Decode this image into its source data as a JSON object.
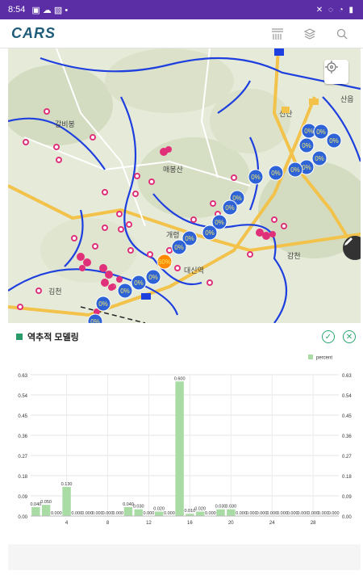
{
  "status_bar": {
    "time": "8:54",
    "icons": [
      "image-icon",
      "cloud-icon",
      "gallery-icon",
      "dot-icon",
      "bluetooth-off-icon",
      "mute-icon",
      "wifi-icon",
      "alarm-icon",
      "battery-icon"
    ]
  },
  "app": {
    "logo": "CARS"
  },
  "toolbar": {
    "icons": [
      "layers-list-icon",
      "layers-icon",
      "search-icon"
    ]
  },
  "map": {
    "labels": [
      "갈비봉",
      "매봉산",
      "개령",
      "대신역",
      "김천",
      "선산",
      "산읍",
      "감천"
    ],
    "bubble_labels": [
      "0%",
      "0%",
      "0%",
      "0%",
      "0%",
      "0%",
      "0%",
      "0%",
      "0%",
      "0%",
      "0%",
      "0%",
      "0%",
      "0%",
      "0%",
      "0%",
      "0%",
      "0%",
      "0%",
      "60%",
      "0%",
      "0%",
      "0%"
    ]
  },
  "panel": {
    "title": "역추적 모델링",
    "confirm_icon": "check-circle-icon",
    "close_icon": "close-circle-icon"
  },
  "chart_data": {
    "type": "bar",
    "legend": "percent",
    "color": "#a9dba5",
    "ylim": [
      0,
      0.63
    ],
    "yticks": [
      "0.00",
      "0.09",
      "0.18",
      "0.27",
      "0.36",
      "0.45",
      "0.54",
      "0.63"
    ],
    "xticks": [
      4,
      8,
      12,
      16,
      20,
      24,
      28
    ],
    "x": [
      1,
      2,
      3,
      4,
      5,
      6,
      7,
      8,
      9,
      10,
      11,
      12,
      13,
      14,
      15,
      16,
      17,
      18,
      19,
      20,
      21,
      22,
      23,
      24,
      25,
      26,
      27,
      28,
      29,
      30
    ],
    "values": [
      0.04,
      0.05,
      0.0,
      0.13,
      0.0,
      0.0,
      0.0,
      0.0,
      0.0,
      0.04,
      0.03,
      0.0,
      0.02,
      0.0,
      0.6,
      0.01,
      0.02,
      0.0,
      0.03,
      0.03,
      0.0,
      0.0,
      0.0,
      0.0,
      0.0,
      0.0,
      0.0,
      0.0,
      0.0,
      0.0
    ],
    "value_labels": [
      "0.040",
      "0.050",
      "0.000",
      "0.130",
      "0.000",
      "0.000",
      "0.000",
      "0.000",
      "0.000",
      "0.040",
      "0.030",
      "0.000",
      "0.020",
      "0.000",
      "0.600",
      "0.010",
      "0.020",
      "0.000",
      "0.030",
      "0.030",
      "0.000",
      "0.000",
      "0.000",
      "0.000",
      "0.000",
      "0.000",
      "0.000",
      "0.000",
      "0.000",
      "0.000"
    ]
  }
}
